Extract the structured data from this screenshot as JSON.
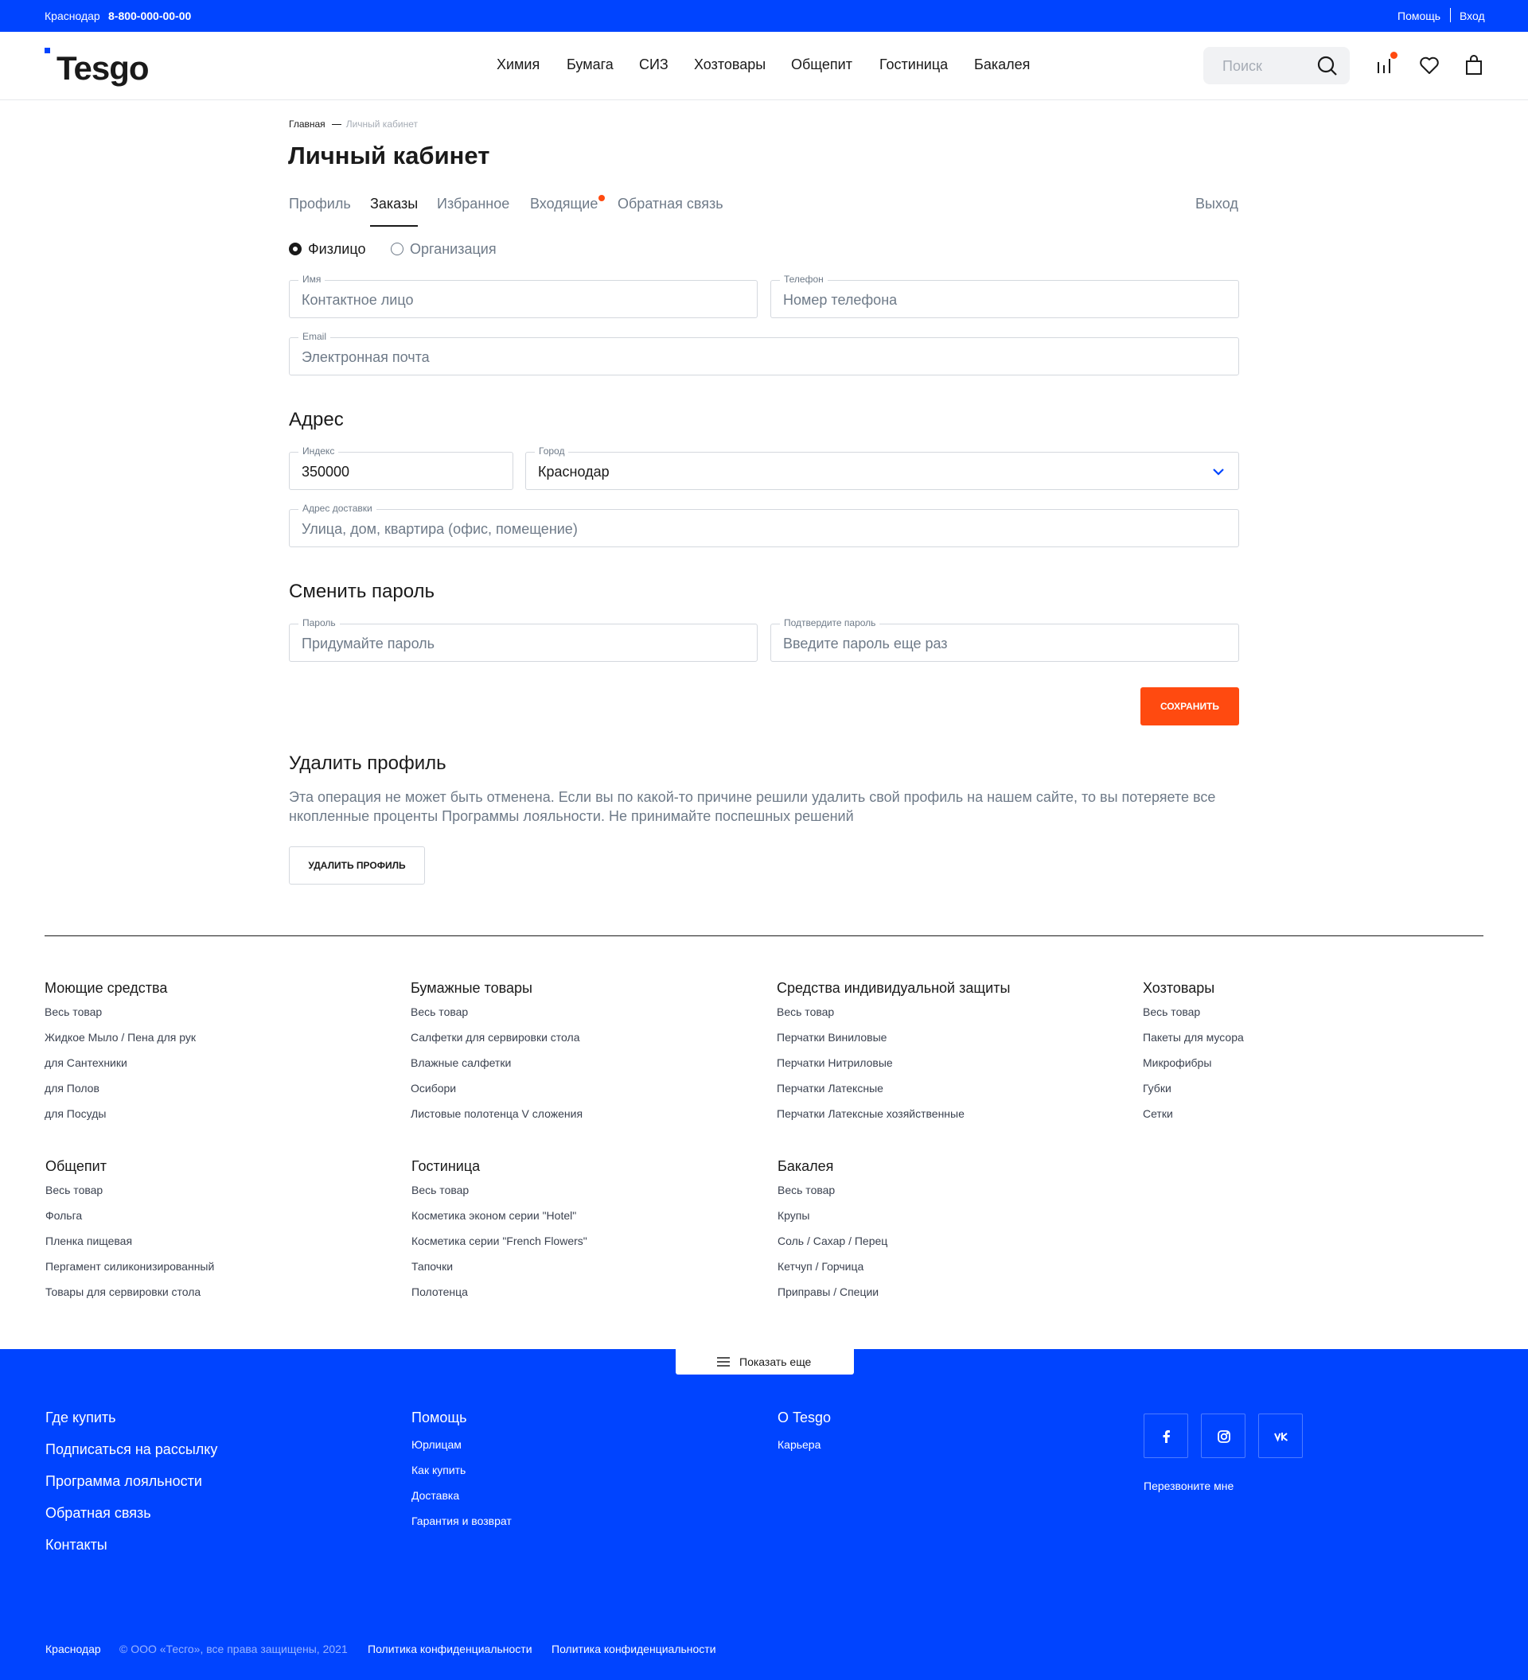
{
  "topbar": {
    "city": "Краснодар",
    "phone": "8-800-000-00-00",
    "help": "Помощь",
    "login": "Вход"
  },
  "header": {
    "logo": "Tesgo",
    "nav": [
      "Химия",
      "Бумага",
      "СИЗ",
      "Хозтовары",
      "Общепит",
      "Гостиница",
      "Бакалея"
    ],
    "search_placeholder": "Поиск",
    "icons": [
      "compare-icon",
      "heart-icon",
      "bag-icon"
    ]
  },
  "breadcrumb": {
    "home": "Главная",
    "current": "Личный кабинет"
  },
  "page_title": "Личный кабинет",
  "tabs": [
    "Профиль",
    "Заказы",
    "Избранное",
    "Входящие",
    "Обратная связь"
  ],
  "active_tab": "Заказы",
  "logout": "Выход",
  "person_type": {
    "options": [
      "Физлицо",
      "Организация"
    ],
    "selected": "Физлицо"
  },
  "form": {
    "name": {
      "label": "Имя",
      "placeholder": "Контактное лицо"
    },
    "phone": {
      "label": "Телефон",
      "placeholder": "Номер телефона"
    },
    "email": {
      "label": "Email",
      "placeholder": "Электронная почта"
    }
  },
  "address": {
    "heading": "Адрес",
    "index": {
      "label": "Индекс",
      "value": "350000"
    },
    "city": {
      "label": "Город",
      "value": "Краснодар"
    },
    "delivery": {
      "label": "Адрес доставки",
      "placeholder": "Улица, дом, квартира (офис, помещение)"
    }
  },
  "password": {
    "heading": "Сменить пароль",
    "new": {
      "label": "Пароль",
      "placeholder": "Придумайте пароль"
    },
    "confirm": {
      "label": "Подтвердите пароль",
      "placeholder": "Введите пароль еще раз"
    }
  },
  "save_label": "СОХРАНИТЬ",
  "delete": {
    "heading": "Удалить профиль",
    "text": "Эта операция не может быть отменена. Если вы по какой-то причине решили удалить свой профиль на нашем сайте, то вы потеряете все нкопленные проценты Программы лояльности. Не принимайте поспешных решений",
    "button": "УДАЛИТЬ ПРОФИЛЬ"
  },
  "footer_categories": [
    {
      "title": "Моющие средства",
      "links": [
        "Весь товар",
        "Жидкое Мыло / Пена для рук",
        "для Сантехники",
        "для Полов",
        "для Посуды"
      ]
    },
    {
      "title": "Бумажные товары",
      "links": [
        "Весь товар",
        "Салфетки для сервировки стола",
        "Влажные салфетки",
        "Осибори",
        "Листовые полотенца V сложения"
      ]
    },
    {
      "title": "Средства индивидуальной защиты",
      "links": [
        "Весь товар",
        "Перчатки Виниловые",
        "Перчатки Нитриловые",
        "Перчатки Латексные",
        "Перчатки Латексные хозяйственные"
      ]
    },
    {
      "title": "Хозтовары",
      "links": [
        "Весь товар",
        "Пакеты для мусора",
        "Микрофибры",
        "Губки",
        "Сетки"
      ]
    },
    {
      "title": "Общепит",
      "links": [
        "Весь товар",
        "Фольга",
        "Пленка пищевая",
        "Пергамент силиконизированный",
        "Товары для сервировки стола"
      ]
    },
    {
      "title": "Гостиница",
      "links": [
        "Весь товар",
        "Косметика эконом серии \"Hotel\"",
        "Косметика серии \"French Flowers\"",
        "Тапочки",
        "Полотенца"
      ]
    },
    {
      "title": "Бакалея",
      "links": [
        "Весь товар",
        "Крупы",
        "Соль / Сахар / Перец",
        "Кетчуп / Горчица",
        "Приправы / Специи"
      ]
    }
  ],
  "show_more": "Показать еще",
  "blue_footer": {
    "main_links": [
      "Где купить",
      "Подписаться на рассылку",
      "Программа лояльности",
      "Обратная связь",
      "Контакты"
    ],
    "help": {
      "title": "Помощь",
      "links": [
        "Юрлицам",
        "Как купить",
        "Доставка",
        "Гарантия и возврат"
      ]
    },
    "about": {
      "title": "О Tesgo",
      "links": [
        "Карьера"
      ]
    },
    "social": [
      "facebook-icon",
      "instagram-icon",
      "vk-icon"
    ],
    "callback": "Перезвоните мне"
  },
  "bottom": {
    "city": "Краснодар",
    "copyright": "© ООО «Тесго», все права защищены, 2021",
    "policy1": "Политика конфиденциальности",
    "policy2": "Политика конфиденциальности"
  },
  "colors": {
    "brand_blue": "#0044ff",
    "accent_orange": "#ff4a10"
  }
}
